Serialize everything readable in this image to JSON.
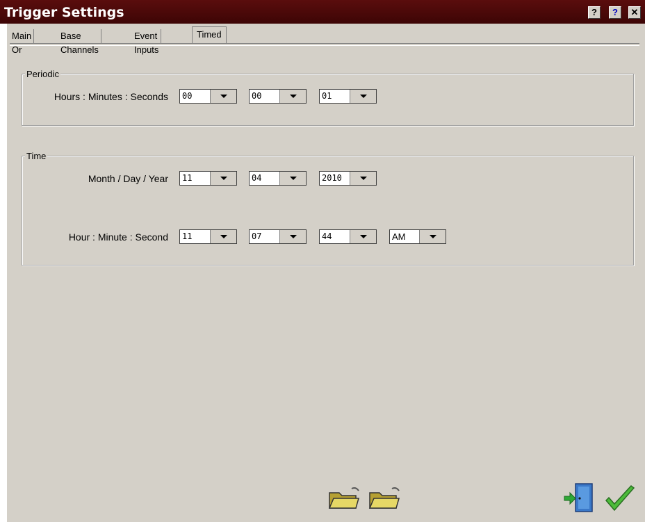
{
  "window": {
    "title": "Trigger Settings"
  },
  "titlebar_buttons": [
    "help-circle-icon",
    "help-icon",
    "close-icon"
  ],
  "tabs": [
    {
      "label": "Main Or"
    },
    {
      "label": "Base Channels"
    },
    {
      "label": "Event Inputs"
    },
    {
      "label": "Timed"
    }
  ],
  "periodic": {
    "label": "Periodic",
    "field_label": "Hours : Minutes : Seconds",
    "hours": "00",
    "minutes": "00",
    "seconds": "01"
  },
  "time": {
    "label": "Time",
    "date_label": "Month / Day / Year",
    "month": "11",
    "day": "04",
    "year": "2010",
    "time_label": "Hour : Minute : Second",
    "hour": "11",
    "minute": "07",
    "second": "44",
    "ampm": "AM"
  },
  "footer": {
    "icons": [
      "folder-open-icon",
      "folder-save-icon",
      "exit-door-icon",
      "ok-checkmark-icon"
    ]
  }
}
